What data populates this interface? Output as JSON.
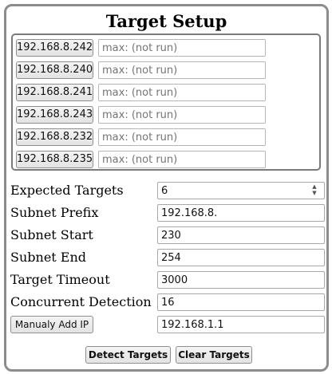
{
  "title": "Target Setup",
  "targets": [
    {
      "ip": "192.168.8.242",
      "placeholder": "max: (not run)"
    },
    {
      "ip": "192.168.8.240",
      "placeholder": "max: (not run)"
    },
    {
      "ip": "192.168.8.241",
      "placeholder": "max: (not run)"
    },
    {
      "ip": "192.168.8.243",
      "placeholder": "max: (not run)"
    },
    {
      "ip": "192.168.8.232",
      "placeholder": "max: (not run)"
    },
    {
      "ip": "192.168.8.235",
      "placeholder": "max: (not run)"
    }
  ],
  "form": {
    "expected_targets": {
      "label": "Expected Targets",
      "value": "6"
    },
    "subnet_prefix": {
      "label": "Subnet Prefix",
      "value": "192.168.8."
    },
    "subnet_start": {
      "label": "Subnet Start",
      "value": "230"
    },
    "subnet_end": {
      "label": "Subnet End",
      "value": "254"
    },
    "target_timeout": {
      "label": "Target Timeout",
      "value": "3000"
    },
    "concurrent_detection": {
      "label": "Concurrent Detection",
      "value": "16"
    },
    "manual_add": {
      "button_label": "Manualy Add IP",
      "value": "192.168.1.1"
    }
  },
  "actions": {
    "detect_label": "Detect Targets",
    "clear_label": "Clear Targets"
  }
}
